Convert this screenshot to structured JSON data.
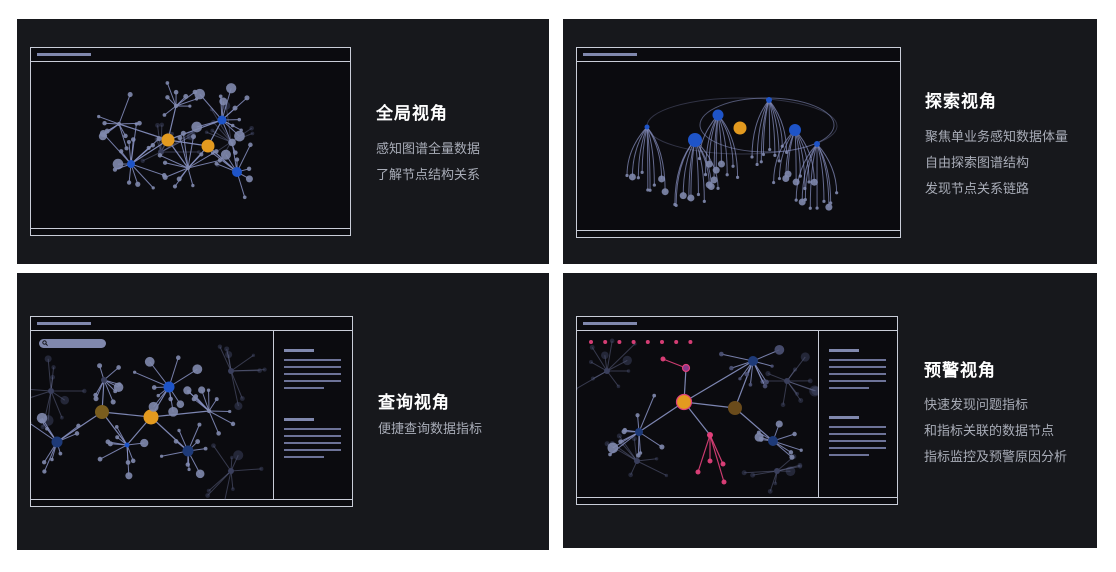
{
  "cards": [
    {
      "id": "global",
      "title": "全局视角",
      "lines": [
        "感知图谱全量数据",
        "了解节点结构关系"
      ]
    },
    {
      "id": "explore",
      "title": "探索视角",
      "lines": [
        "聚焦单业务感知数据体量",
        "自由探索图谱结构",
        "发现节点关系链路"
      ]
    },
    {
      "id": "query",
      "title": "查询视角",
      "lines": [
        "便捷查询数据指标"
      ]
    },
    {
      "id": "alert",
      "title": "预警视角",
      "lines": [
        "快速发现问题指标",
        "和指标关联的数据节点",
        "指标监控及预警原因分析"
      ]
    }
  ],
  "colors": {
    "panel_bg": "#17181c",
    "node_blue": "#1e54c8",
    "node_orange": "#e39a1f",
    "node_pink": "#e0407a",
    "edge": "#8a93c4",
    "frame_border": "#c9cdd8"
  },
  "icons": {
    "search": "search-icon"
  }
}
